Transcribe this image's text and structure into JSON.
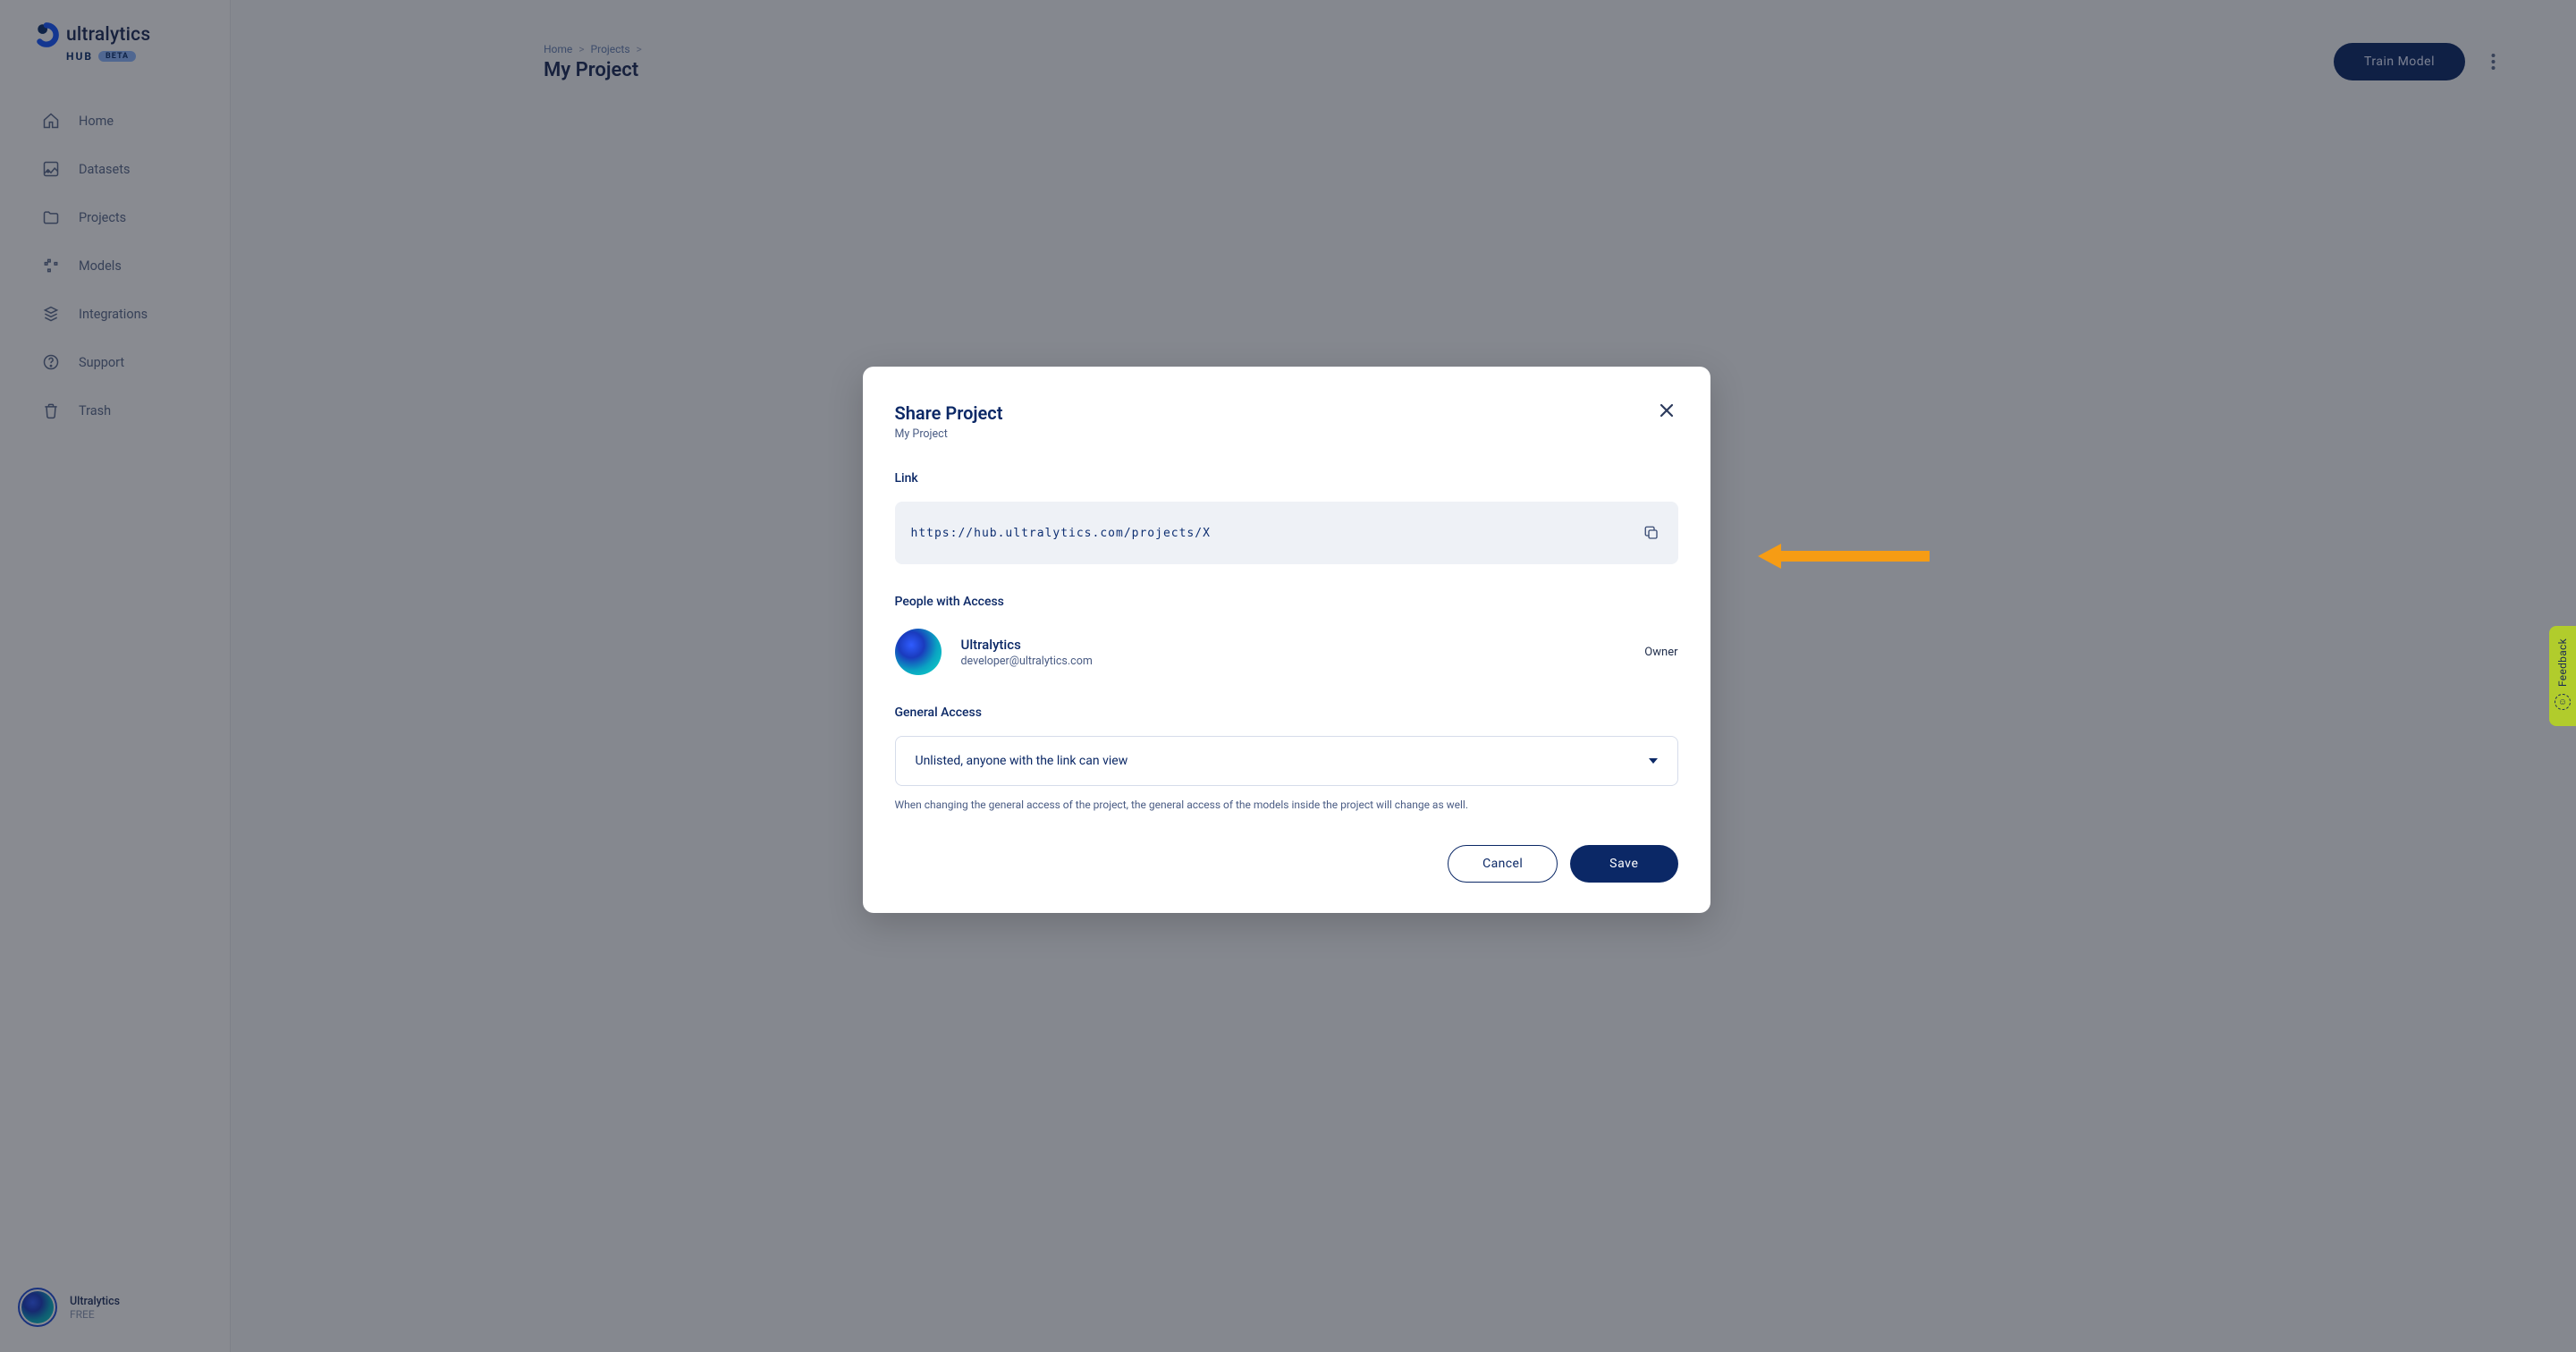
{
  "brand": {
    "name": "ultralytics",
    "hub": "HUB",
    "beta": "BETA"
  },
  "sidebar": {
    "items": [
      {
        "label": "Home"
      },
      {
        "label": "Datasets"
      },
      {
        "label": "Projects"
      },
      {
        "label": "Models"
      },
      {
        "label": "Integrations"
      },
      {
        "label": "Support"
      },
      {
        "label": "Trash"
      }
    ],
    "user": {
      "name": "Ultralytics",
      "plan": "FREE"
    }
  },
  "header": {
    "breadcrumb": {
      "home": "Home",
      "projects": "Projects"
    },
    "title": "My Project",
    "train_label": "Train Model"
  },
  "modal": {
    "title": "Share Project",
    "subtitle": "My Project",
    "link_label": "Link",
    "link_value": "https://hub.ultralytics.com/projects/X",
    "people_label": "People with Access",
    "person": {
      "name": "Ultralytics",
      "email": "developer@ultralytics.com",
      "role": "Owner"
    },
    "general_label": "General Access",
    "general_selected": "Unlisted, anyone with the link can view",
    "general_help": "When changing the general access of the project, the general access of the models inside the project will change as well.",
    "cancel_label": "Cancel",
    "save_label": "Save"
  },
  "feedback": {
    "label": "Feedback"
  }
}
